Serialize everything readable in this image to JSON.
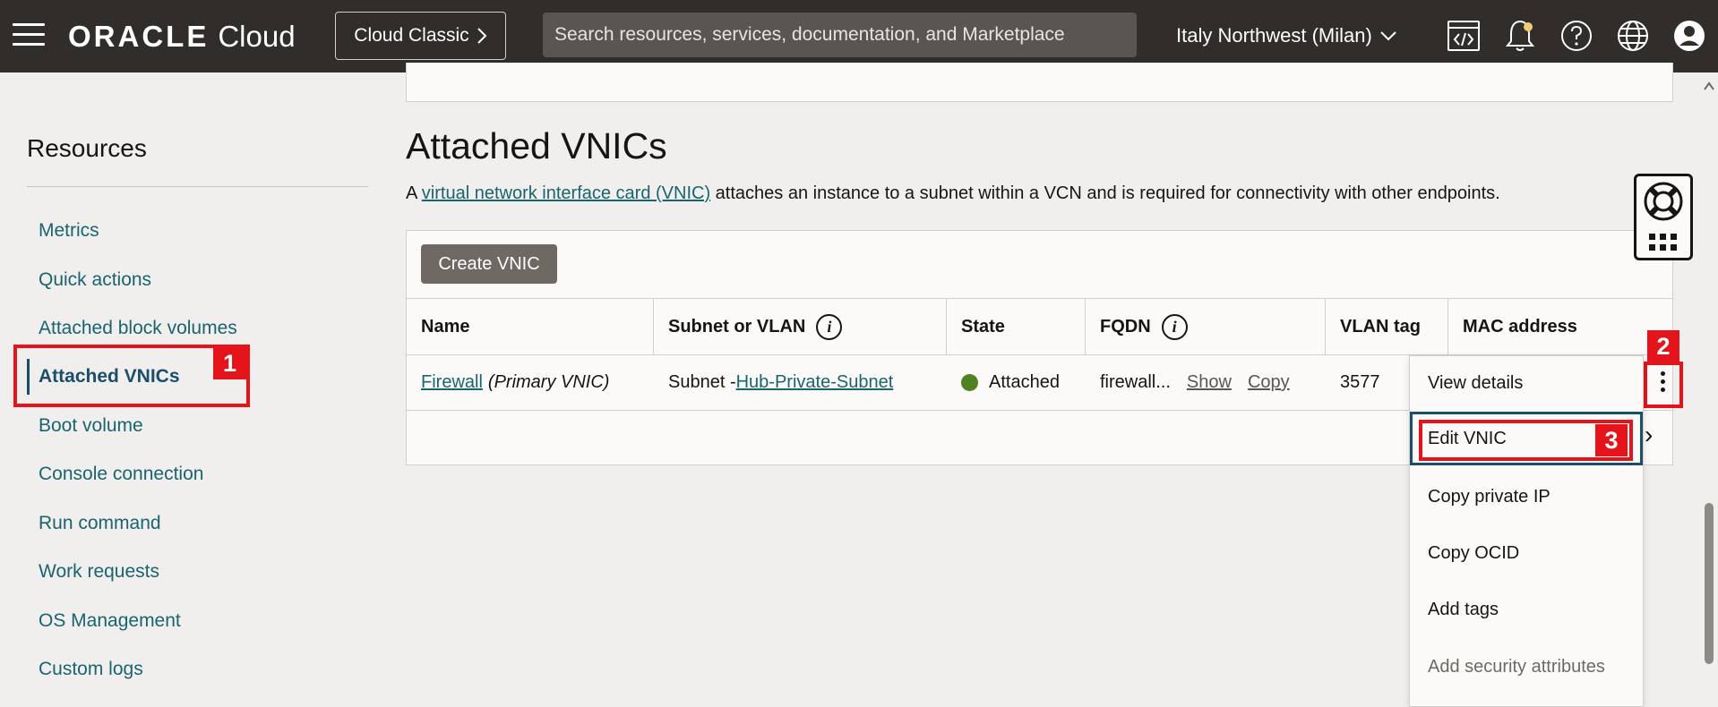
{
  "topbar": {
    "brand": "ORACLE",
    "product": "Cloud",
    "classic_button": "Cloud Classic",
    "search_placeholder": "Search resources, services, documentation, and Marketplace",
    "region": "Italy Northwest (Milan)",
    "icons": [
      "code-editor-icon",
      "bell-icon",
      "help-icon",
      "globe-icon",
      "user-icon"
    ]
  },
  "sidebar": {
    "title": "Resources",
    "items": [
      {
        "label": "Metrics"
      },
      {
        "label": "Quick actions"
      },
      {
        "label": "Attached block volumes"
      },
      {
        "label": "Attached VNICs",
        "active": true
      },
      {
        "label": "Boot volume"
      },
      {
        "label": "Console connection"
      },
      {
        "label": "Run command"
      },
      {
        "label": "Work requests"
      },
      {
        "label": "OS Management"
      },
      {
        "label": "Custom logs"
      }
    ]
  },
  "main": {
    "title": "Attached VNICs",
    "desc_prefix": "A ",
    "desc_link": "virtual network interface card (VNIC)",
    "desc_suffix": " attaches an instance to a subnet within a VCN and is required for connectivity with other endpoints.",
    "create_button": "Create VNIC",
    "columns": [
      "Name",
      "Subnet or VLAN",
      "State",
      "FQDN",
      "VLAN tag",
      "MAC address"
    ],
    "row": {
      "name_link": "Firewall",
      "name_suffix": "(Primary VNIC)",
      "subnet_prefix": "Subnet - ",
      "subnet_link": "Hub-Private-Subnet",
      "state": "Attached",
      "fqdn": "firewall...",
      "fqdn_show": "Show",
      "fqdn_copy": "Copy",
      "vlan_tag": "3577"
    }
  },
  "action_menu": {
    "items": [
      {
        "label": "View details"
      },
      {
        "label": "Edit VNIC",
        "focused": true
      },
      {
        "label": "Copy private IP"
      },
      {
        "label": "Copy OCID"
      },
      {
        "label": "Add tags"
      },
      {
        "label": "Add security attributes",
        "disabled": true
      }
    ]
  },
  "annotations": {
    "one": "1",
    "two": "2",
    "three": "3",
    "color": "#e5141a"
  },
  "colors": {
    "header_bg": "#312d2a",
    "link": "#19646f",
    "status_green": "#508223"
  }
}
